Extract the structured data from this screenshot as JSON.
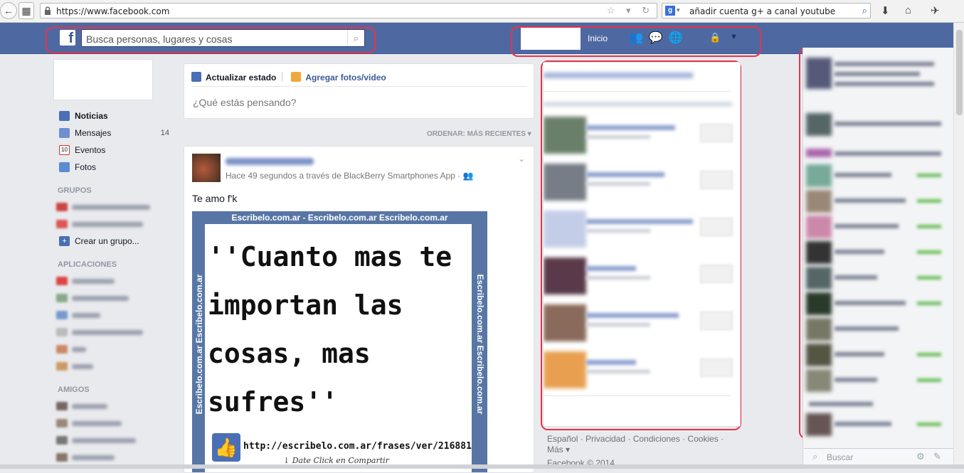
{
  "browser": {
    "url": "https://www.facebook.com",
    "search_query": "añadir cuenta g+ a canal youtube",
    "search_engine_icon": "google-g-icon"
  },
  "fb_topbar": {
    "logo_letter": "f",
    "search_placeholder": "Busca personas, lugares y cosas",
    "home_label": "Inicio"
  },
  "left_nav": {
    "items": [
      {
        "label": "Noticias",
        "icon": "news-feed-icon",
        "count": ""
      },
      {
        "label": "Mensajes",
        "icon": "messages-icon",
        "count": "14"
      },
      {
        "label": "Eventos",
        "icon": "events-calendar-icon",
        "count": ""
      },
      {
        "label": "Fotos",
        "icon": "photos-icon",
        "count": ""
      }
    ],
    "groups_heading": "GRUPOS",
    "create_group": "Crear un grupo...",
    "apps_heading": "APLICACIONES",
    "friends_heading": "AMIGOS"
  },
  "composer": {
    "tab_status": "Actualizar estado",
    "tab_photo": "Agregar fotos/video",
    "placeholder": "¿Qué estás pensando?"
  },
  "sort_label": "ORDENAR: MÁS RECIENTES",
  "post": {
    "meta": "Hace 49 segundos a través de BlackBerry Smartphones App ·",
    "text": "Te amo f'k",
    "image": {
      "watermark": "Escribelo.com.ar - Escribelo.com.ar Escribelo.com.ar",
      "side_watermark": "Escribelo.com.ar Escribelo.com.ar",
      "quote": "''Cuanto mas te importan las cosas, mas sufres''",
      "url": "http://escribelo.com.ar/frases/ver/216881",
      "cta": "↓ Date Click en Compartir"
    }
  },
  "footer": {
    "links": "Español · Privacidad · Condiciones · Cookies ·",
    "more": "Más ▾",
    "copyright": "Facebook © 2014"
  },
  "chat": {
    "search_label": "Buscar"
  },
  "colors": {
    "fb_blue": "#4e69a2",
    "highlight_red": "#e8334a",
    "online_green": "#6cc05c"
  }
}
